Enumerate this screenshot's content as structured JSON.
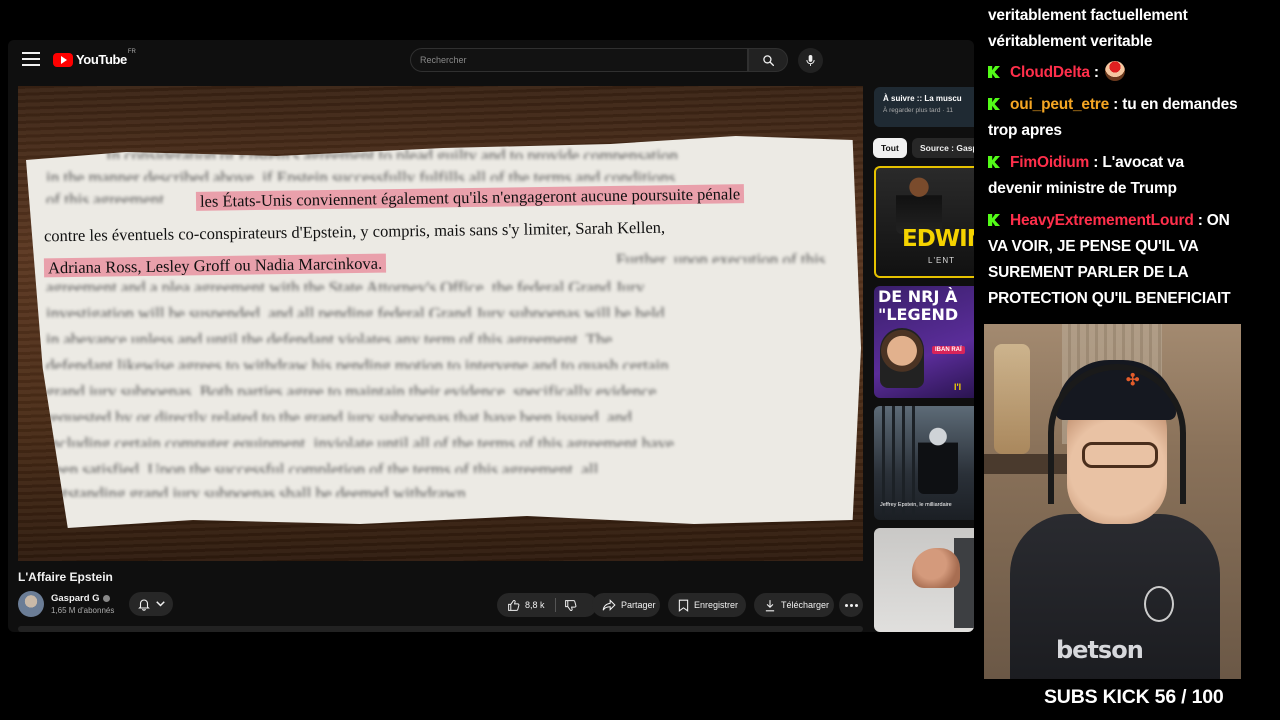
{
  "youtube": {
    "logo_text": "YouTube",
    "logo_region": "FR",
    "search_placeholder": "Rechercher",
    "video": {
      "title": "L'Affaire Epstein",
      "channel": "Gaspard G",
      "subscribers": "1,65 M d'abonnés",
      "like_count": "8,8 k",
      "share_label": "Partager",
      "save_label": "Enregistrer",
      "download_label": "Télécharger"
    },
    "document": {
      "blurred_lines": [
        "In consideration of Epstein's agreement to plead guilty and to provide compensation",
        "in the manner described above, if Epstein successfully fulfills all of the terms and conditions",
        "of this agreement,",
        "",
        "",
        "Further, upon execution of this",
        "agreement and a plea agreement with the State Attorney's Office, the federal Grand Jury",
        "investigation will be suspended, and all pending federal Grand Jury subpoenas will be held",
        "in abeyance unless and until the defendant violates any term of this agreement. The",
        "defendant likewise agrees to withdraw his pending motion to intervene and to quash certain",
        "grand jury subpoenas. Both parties agree to maintain their evidence, specifically evidence",
        "requested by or directly related to the grand jury subpoenas that have been issued, and",
        "including certain computer equipment, inviolate until all of the terms of this agreement have",
        "been satisfied. Upon the successful completion of the terms of this agreement, all",
        "outstanding grand jury subpoenas shall be deemed withdrawn."
      ],
      "highlight": [
        "les États-Unis conviennent également qu'ils n'engageront aucune poursuite pénale",
        "contre les éventuels co-conspirateurs d'Epstein, y compris, mais sans s'y limiter, Sarah Kellen,",
        "Adriana Ross, Lesley Groff ou Nadia Marcinkova."
      ]
    },
    "sidebar": {
      "up_next_title": "À suivre :: La muscu",
      "up_next_sub": "À regarder plus tard · 11",
      "chips": [
        "Tout",
        "Source : Gaspard G"
      ],
      "thumb1_big": "EDWIN",
      "thumb1_small": "L'ENT",
      "thumb2_line1": "DE NRJ À",
      "thumb2_line2": "\"LEGEND",
      "thumb2_tag": "IBAN RAÏ",
      "thumb2_tag2": "l'I",
      "thumb3_caption": "Jeffrey Epstein, le milliardaire"
    }
  },
  "chat": {
    "messages": [
      {
        "user": "",
        "text": "veritablement factuellement"
      },
      {
        "user": "",
        "text": "véritablement veritable"
      },
      {
        "user": "CloudDelta",
        "text": ""
      },
      {
        "user": "oui_peut_etre",
        "text": "tu en demandes"
      },
      {
        "user": "",
        "text": "trop apres"
      },
      {
        "user": "FimOidium",
        "text": "L'avocat va"
      },
      {
        "user": "",
        "text": "devenir ministre de Trump"
      },
      {
        "user": "HeavyExtremementLourd",
        "text": "ON"
      },
      {
        "user": "",
        "text": "VA VOIR, JE PENSE QU'IL VA"
      },
      {
        "user": "",
        "text": "SUREMENT PARLER DE LA"
      },
      {
        "user": "",
        "text": "PROTECTION QU'IL BENEFICIAIT"
      }
    ],
    "colors": {
      "kick_green": "#53fc18",
      "user_red": "#ff2f4b",
      "user_orange": "#f5a623"
    }
  },
  "webcam": {
    "jersey_text": "betson"
  },
  "overlay": {
    "subs_counter": "SUBS KICK 56 / 100"
  },
  "icons": [
    "menu-icon",
    "youtube-logo-icon",
    "search-icon",
    "mic-icon",
    "verified-icon",
    "bell-icon",
    "chevron-down-icon",
    "like-icon",
    "dislike-icon",
    "share-icon",
    "save-icon",
    "download-icon",
    "more-icon",
    "kick-icon",
    "emote-icon"
  ]
}
